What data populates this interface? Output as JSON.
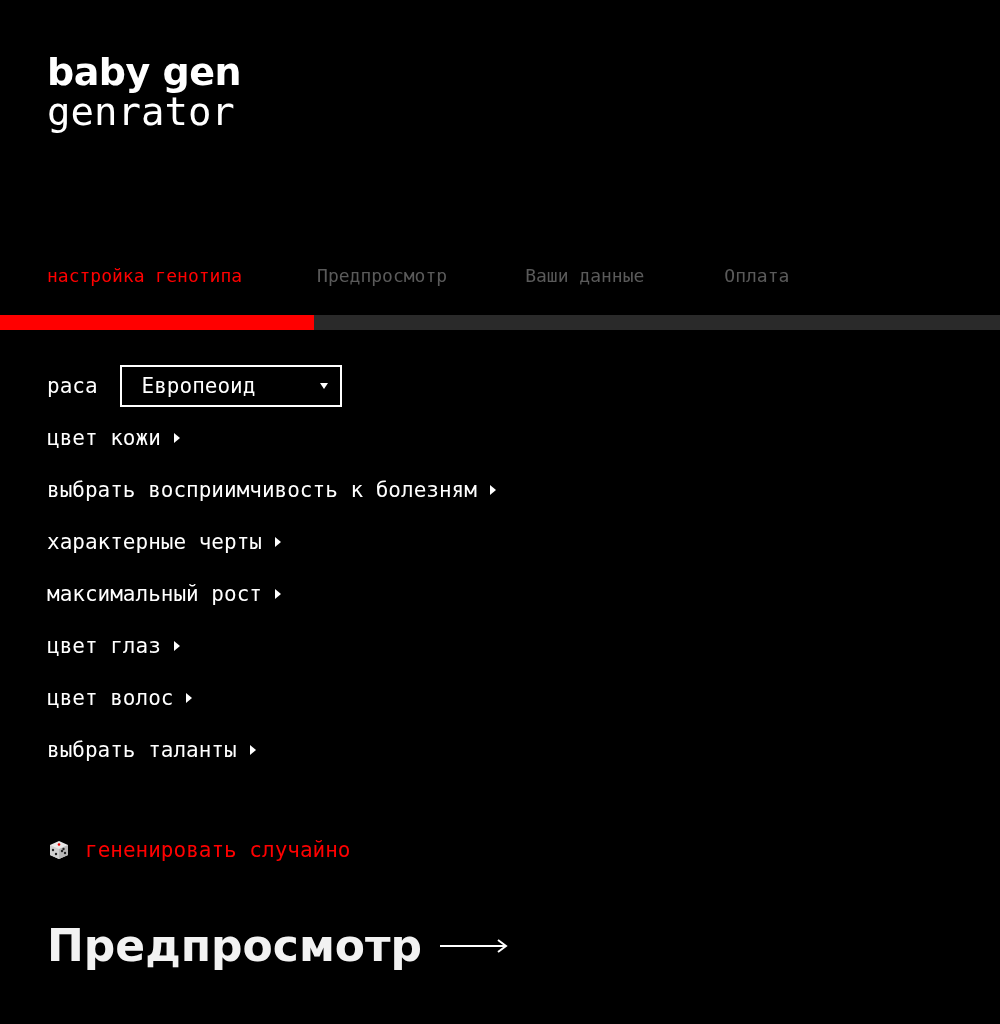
{
  "logo": {
    "line_1": "baby gen",
    "line_2": "genrator"
  },
  "tabs": [
    {
      "label": "настройка генотипа",
      "selected": true
    },
    {
      "label": "Предпросмотр",
      "selected": false
    },
    {
      "label": "Ваши данные",
      "selected": false
    },
    {
      "label": "Оплата",
      "selected": false
    }
  ],
  "progress": {
    "level": 0.314
  },
  "options": [
    {
      "kind": "select",
      "label": "раса",
      "value": "Европеоид"
    },
    {
      "kind": "expander",
      "label": "цвет кожи",
      "expanded": false
    },
    {
      "kind": "expander",
      "label": "выбрать восприимчивость к болезням",
      "expanded": false
    },
    {
      "kind": "expander",
      "label": "характерные черты",
      "expanded": false
    },
    {
      "kind": "expander",
      "label": "максимальный рост",
      "expanded": false
    },
    {
      "kind": "expander",
      "label": "цвет глаз",
      "expanded": false
    },
    {
      "kind": "expander",
      "label": "цвет волос",
      "expanded": false
    },
    {
      "kind": "expander",
      "label": "выбрать таланты",
      "expanded": false
    }
  ],
  "random_link": "гененировать случайно",
  "next_button": "Предпросмотр"
}
